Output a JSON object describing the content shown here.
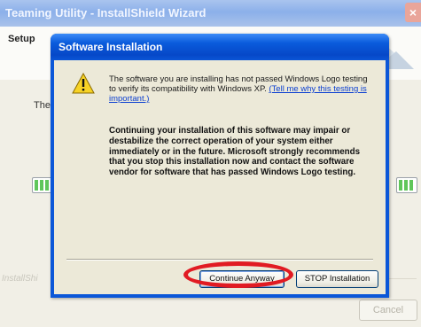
{
  "background_window": {
    "title": "Teaming Utility - InstallShield Wizard",
    "close_glyph": "×",
    "header_label": "Setup",
    "body_text_prefix": "The I",
    "brand": "InstallShi",
    "cancel_label": "Cancel"
  },
  "dialog": {
    "title": "Software Installation",
    "message_intro": "The software you are installing has not passed Windows Logo testing to verify its compatibility with Windows XP. ",
    "message_link": "(Tell me why this testing is important.)",
    "message_bold": "Continuing your installation of this software may impair or destabilize the correct operation of your system either immediately or in the future. Microsoft strongly recommends that you stop this installation now and contact the software vendor for software that has passed Windows Logo testing.",
    "continue_label": "Continue Anyway",
    "stop_label": "STOP Installation",
    "warning_icon": "warning-triangle-icon"
  },
  "colors": {
    "dialog_title_blue": "#0b57d8",
    "annotation_red": "#e11b23",
    "progress_green": "#5fc65a"
  }
}
